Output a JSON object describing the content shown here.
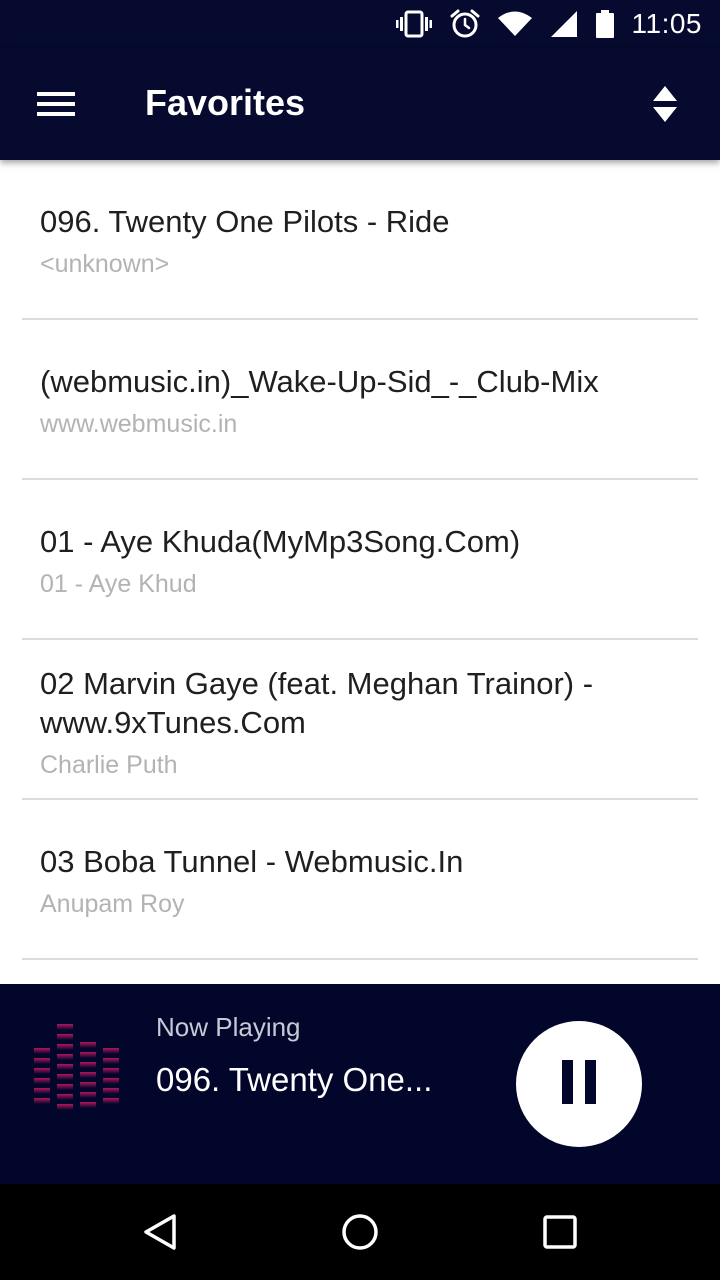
{
  "status_bar": {
    "time": "11:05",
    "icons": [
      "vibrate-icon",
      "alarm-icon",
      "wifi-icon",
      "signal-icon",
      "battery-icon"
    ]
  },
  "app_bar": {
    "title": "Favorites",
    "menu_icon": "hamburger-menu-icon",
    "sort_icon": "sort-icon",
    "background": "#050a2e"
  },
  "songs": [
    {
      "title": "096. Twenty One Pilots - Ride",
      "subtitle": "<unknown>"
    },
    {
      "title": "(webmusic.in)_Wake-Up-Sid_-_Club-Mix",
      "subtitle": "www.webmusic.in"
    },
    {
      "title": "01 - Aye Khuda(MyMp3Song.Com)",
      "subtitle": "01 - Aye Khud"
    },
    {
      "title": "02 Marvin Gaye (feat. Meghan Trainor) - www.9xTunes.Com",
      "subtitle": "Charlie Puth"
    },
    {
      "title": "03 Boba Tunnel - Webmusic.In",
      "subtitle": "Anupam Roy"
    }
  ],
  "now_playing": {
    "label": "Now Playing",
    "title": "096. Twenty One...",
    "art_icon": "equalizer-icon",
    "control_icon": "pause-icon",
    "background": "#03062b"
  },
  "nav_bar": {
    "icons": [
      "back-icon",
      "home-icon",
      "recents-icon"
    ]
  }
}
